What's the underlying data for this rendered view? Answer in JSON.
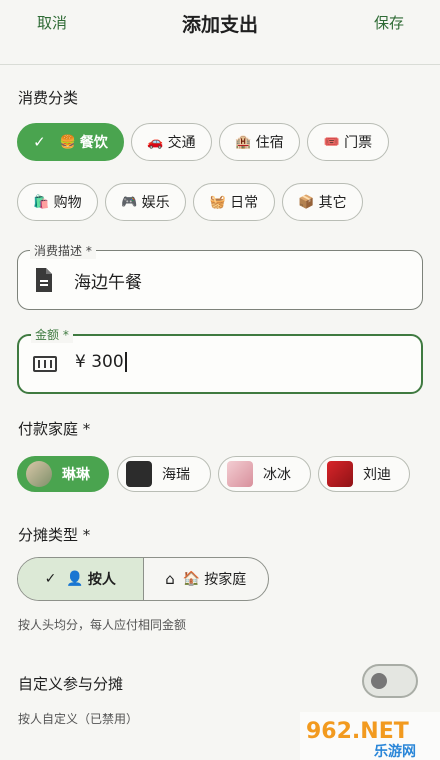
{
  "header": {
    "cancel": "取消",
    "title": "添加支出",
    "save": "保存"
  },
  "category": {
    "label": "消费分类",
    "items": [
      {
        "icon": "🍔",
        "label": "餐饮",
        "selected": true
      },
      {
        "icon": "🚗",
        "label": "交通"
      },
      {
        "icon": "🏨",
        "label": "住宿"
      },
      {
        "icon": "🎟️",
        "label": "门票"
      },
      {
        "icon": "🛍️",
        "label": "购物"
      },
      {
        "icon": "🎮",
        "label": "娱乐"
      },
      {
        "icon": "🧺",
        "label": "日常"
      },
      {
        "icon": "📦",
        "label": "其它"
      }
    ]
  },
  "description": {
    "legend": "消费描述 *",
    "value": "海边午餐"
  },
  "amount": {
    "legend": "金额 *",
    "value": "¥ 300"
  },
  "payer": {
    "label": "付款家庭 *",
    "items": [
      {
        "name": "琳琳",
        "selected": true
      },
      {
        "name": "海瑞"
      },
      {
        "name": "冰冰"
      },
      {
        "name": "刘迪"
      }
    ]
  },
  "split": {
    "label": "分摊类型 *",
    "options": [
      {
        "icon": "👤",
        "label": "按人",
        "selected": true
      },
      {
        "icon": "🏠",
        "label": "按家庭"
      }
    ],
    "hint": "按人头均分，每人应付相同金额"
  },
  "custom": {
    "label": "自定义参与分摊",
    "hint": "按人自定义（已禁用）",
    "enabled": false
  },
  "watermark": {
    "brand": "962.NET",
    "sub": "乐游网"
  },
  "colors": {
    "accent": "#4aa44f",
    "primary_text": "#2f6b35"
  }
}
